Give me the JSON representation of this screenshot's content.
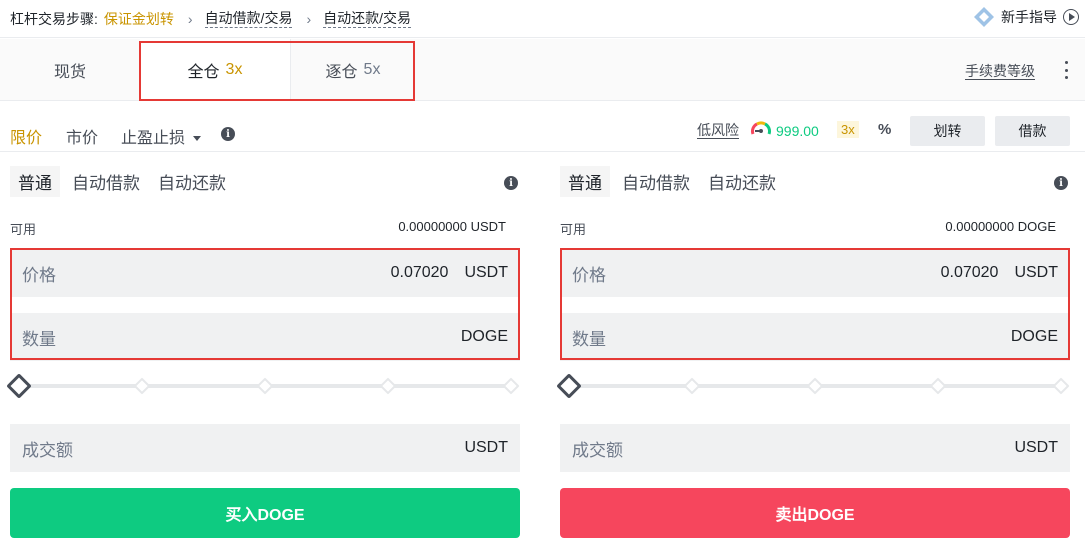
{
  "guide": {
    "title": "杠杆交易步骤:",
    "step1": "保证金划转",
    "step2": "自动借款/交易",
    "step3": "自动还款/交易",
    "newbie": "新手指导"
  },
  "tabs": {
    "spot": "现货",
    "cross": "全仓",
    "cross_lev": "3x",
    "isolated": "逐仓",
    "isolated_lev": "5x",
    "fee_level": "手续费等级"
  },
  "order_types": {
    "limit": "限价",
    "market": "市价",
    "stop_limit": "止盈止损"
  },
  "risk": {
    "label": "低风险",
    "value": "999.00",
    "leverage": "3x",
    "transfer": "划转",
    "borrow": "借款"
  },
  "modes": [
    "普通",
    "自动借款",
    "自动还款"
  ],
  "buy": {
    "available_label": "可用",
    "available_value": "0.00000000 USDT",
    "price_label": "价格",
    "price_value": "0.07020",
    "price_unit": "USDT",
    "qty_label": "数量",
    "qty_unit": "DOGE",
    "total_label": "成交额",
    "total_unit": "USDT",
    "slider_percent": 0,
    "action": "买入DOGE"
  },
  "sell": {
    "available_label": "可用",
    "available_value": "0.00000000 DOGE",
    "price_label": "价格",
    "price_value": "0.07020",
    "price_unit": "USDT",
    "qty_label": "数量",
    "qty_unit": "DOGE",
    "total_label": "成交额",
    "total_unit": "USDT",
    "slider_percent": 0,
    "action": "卖出DOGE"
  },
  "colors": {
    "accent": "#c99400",
    "buy": "#0ecb81",
    "sell": "#f6465d",
    "highlight": "#e53935"
  }
}
